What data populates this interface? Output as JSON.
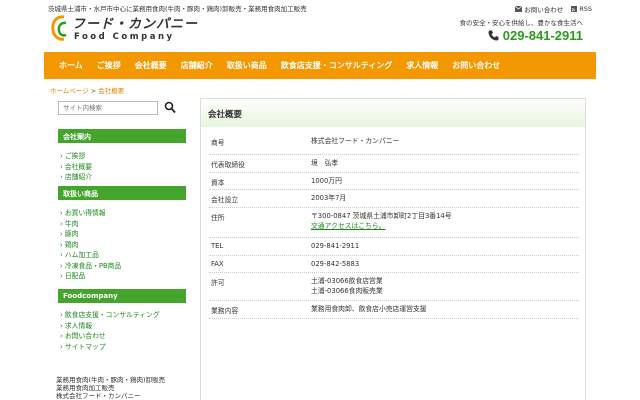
{
  "header": {
    "tagline": "茨城県土浦市・水戸市中心に業務用食肉(牛肉・豚肉・鶏肉)卸販売・業務用食肉加工販売",
    "logo_jp": "フード・カンパニー",
    "logo_en": "Food Company",
    "links": [
      {
        "label": "お問い合わせ",
        "icon": "mail-icon"
      },
      {
        "label": "RSS",
        "icon": "rss-icon"
      }
    ],
    "subtext": "食の安全・安心を供給し、豊かな食生活へ",
    "phone": "029-841-2911",
    "brand_color": "#f39800",
    "accent_color": "#2b9a1f"
  },
  "nav": [
    "ホーム",
    "ご挨拶",
    "会社概要",
    "店舗紹介",
    "取扱い商品",
    "飲食店支援・コンサルティング",
    "求人情報",
    "お問い合わせ"
  ],
  "breadcrumb": {
    "home": "ホームページ",
    "sep": ">",
    "current": "会社概要"
  },
  "search": {
    "placeholder": "サイト内検索"
  },
  "sidebar": {
    "sections": [
      {
        "title": "会社案内",
        "items": [
          "ご挨拶",
          "会社概要",
          "店舗紹介"
        ]
      },
      {
        "title": "取扱い商品",
        "items": [
          "お買い得情報",
          "牛肉",
          "豚肉",
          "鶏肉",
          "ハム加工品",
          "冷凍食品・PB商品",
          "日配品"
        ]
      },
      {
        "title": "Foodcompany",
        "items": [
          "飲食店支援・コンサルティング",
          "求人情報",
          "お問い合わせ",
          "サイトマップ"
        ]
      }
    ]
  },
  "footer_lines": [
    "業務用食肉(牛肉・豚肉・鶏肉)卸販売",
    "業務用食肉加工販売",
    "株式会社フード・カンパニー"
  ],
  "main": {
    "title": "会社概要",
    "rows": [
      {
        "key": "商号",
        "lines": [
          "株式会社フード・カンパニー"
        ]
      },
      {
        "key": "代表取締役",
        "lines": [
          "境　弘孝"
        ]
      },
      {
        "key": "資本",
        "lines": [
          "1000万円"
        ]
      },
      {
        "key": "会社設立",
        "lines": [
          "2003年7月"
        ]
      },
      {
        "key": "住所",
        "lines": [
          "〒300-0847 茨城県土浦市卸町2丁目3番14号"
        ],
        "link": "交通アクセスはこちら。"
      },
      {
        "key": "TEL",
        "lines": [
          "029-841-2911"
        ]
      },
      {
        "key": "FAX",
        "lines": [
          "029-842-5883"
        ]
      },
      {
        "key": "許可",
        "lines": [
          "土浦-03066飲食店営業",
          "土浦-03066食肉販売業"
        ]
      },
      {
        "key": "業務内容",
        "lines": [
          "業務用食肉卸、飲食店小売店運営支援"
        ]
      }
    ]
  }
}
